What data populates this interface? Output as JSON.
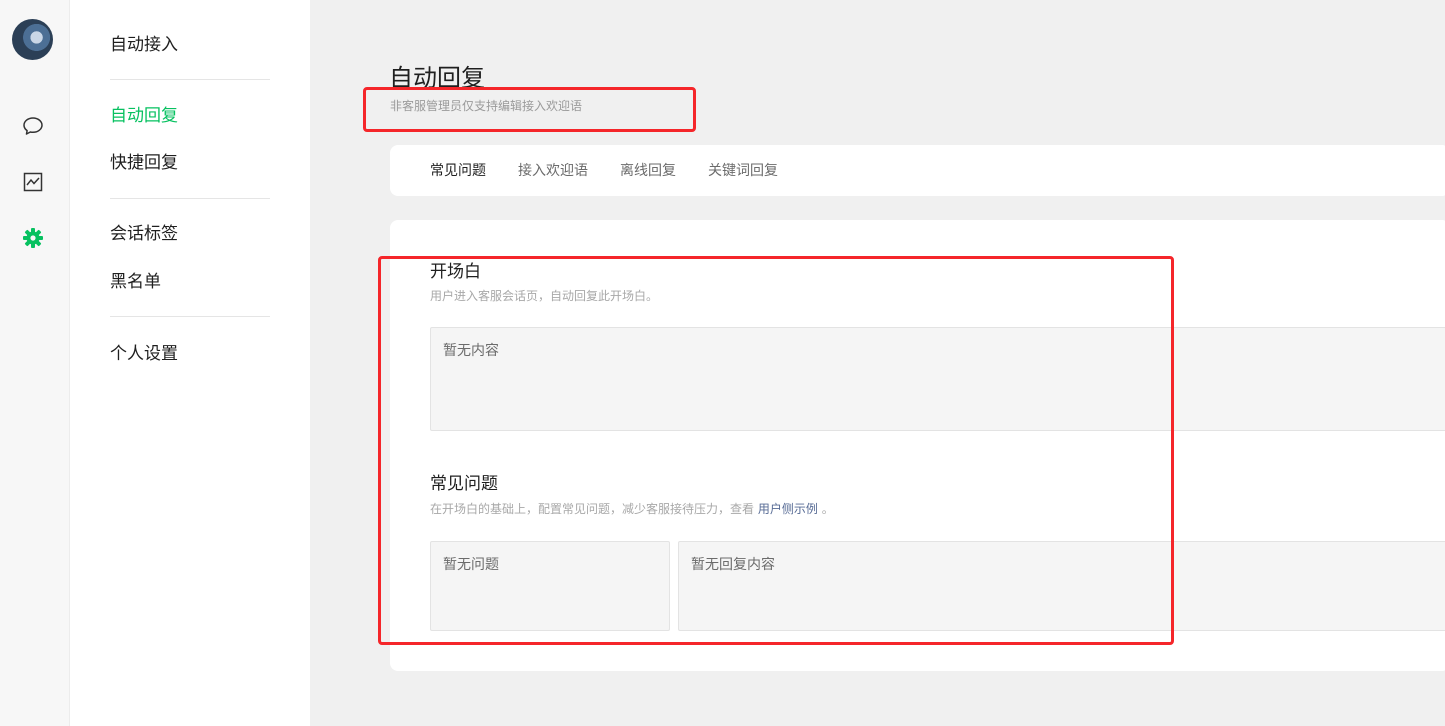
{
  "rail": {
    "avatar": "user-avatar",
    "icons": [
      "chat-bubble-icon",
      "analytics-chart-icon",
      "gear-icon"
    ],
    "active_color": "#07c160"
  },
  "subnav": {
    "items": [
      {
        "label": "自动接入"
      },
      {
        "label": "自动回复",
        "active": true
      },
      {
        "label": "快捷回复"
      },
      {
        "label": "会话标签"
      },
      {
        "label": "黑名单"
      },
      {
        "label": "个人设置"
      }
    ]
  },
  "page": {
    "title": "自动回复",
    "subtitle": "非客服管理员仅支持编辑接入欢迎语"
  },
  "tabs": [
    {
      "label": "常见问题",
      "active": true
    },
    {
      "label": "接入欢迎语"
    },
    {
      "label": "离线回复"
    },
    {
      "label": "关键词回复"
    }
  ],
  "opening": {
    "title": "开场白",
    "desc": "用户进入客服会话页，自动回复此开场白。",
    "empty": "暂无内容"
  },
  "faq": {
    "title": "常见问题",
    "desc_prefix": "在开场白的基础上，配置常见问题，减少客服接待压力，查看",
    "desc_link": "用户侧示例",
    "desc_suffix": "。",
    "question_empty": "暂无问题",
    "answer_empty": "暂无回复内容"
  },
  "highlight_color": "#f5262a"
}
